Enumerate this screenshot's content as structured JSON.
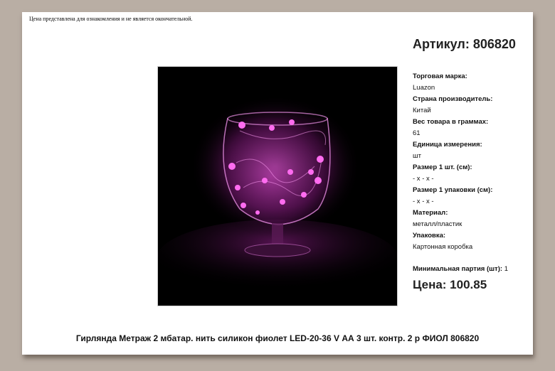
{
  "disclaimer": "Цена представлена для ознакомления и не является окончательной.",
  "article": "Артикул: 806820",
  "specs": [
    {
      "label": "Торговая марка:",
      "value": "Luazon"
    },
    {
      "label": "Страна производитель:",
      "value": "Китай"
    },
    {
      "label": "Вес товара в граммах:",
      "value": "61"
    },
    {
      "label": "Единица измерения:",
      "value": "шт"
    },
    {
      "label": "Размер 1 шт. (см):",
      "value": "- х - х -"
    },
    {
      "label": "Размер 1 упаковки (см):",
      "value": "- х - х -"
    },
    {
      "label": "Материал:",
      "value": "металл/пластик"
    },
    {
      "label": "Упаковка:",
      "value": "Картонная коробка"
    }
  ],
  "min_order": {
    "label": "Минимальная партия (шт):",
    "value": "1"
  },
  "price": "Цена: 100.85",
  "product_title": "Гирлянда Метраж 2 мбатар. нить силикон фиолет LED-20-36 V АА 3 шт. контр. 2 р ФИОЛ 806820",
  "colors": {
    "background": "#b9aea4",
    "sheet": "#ffffff",
    "led": "#e84bd8"
  }
}
